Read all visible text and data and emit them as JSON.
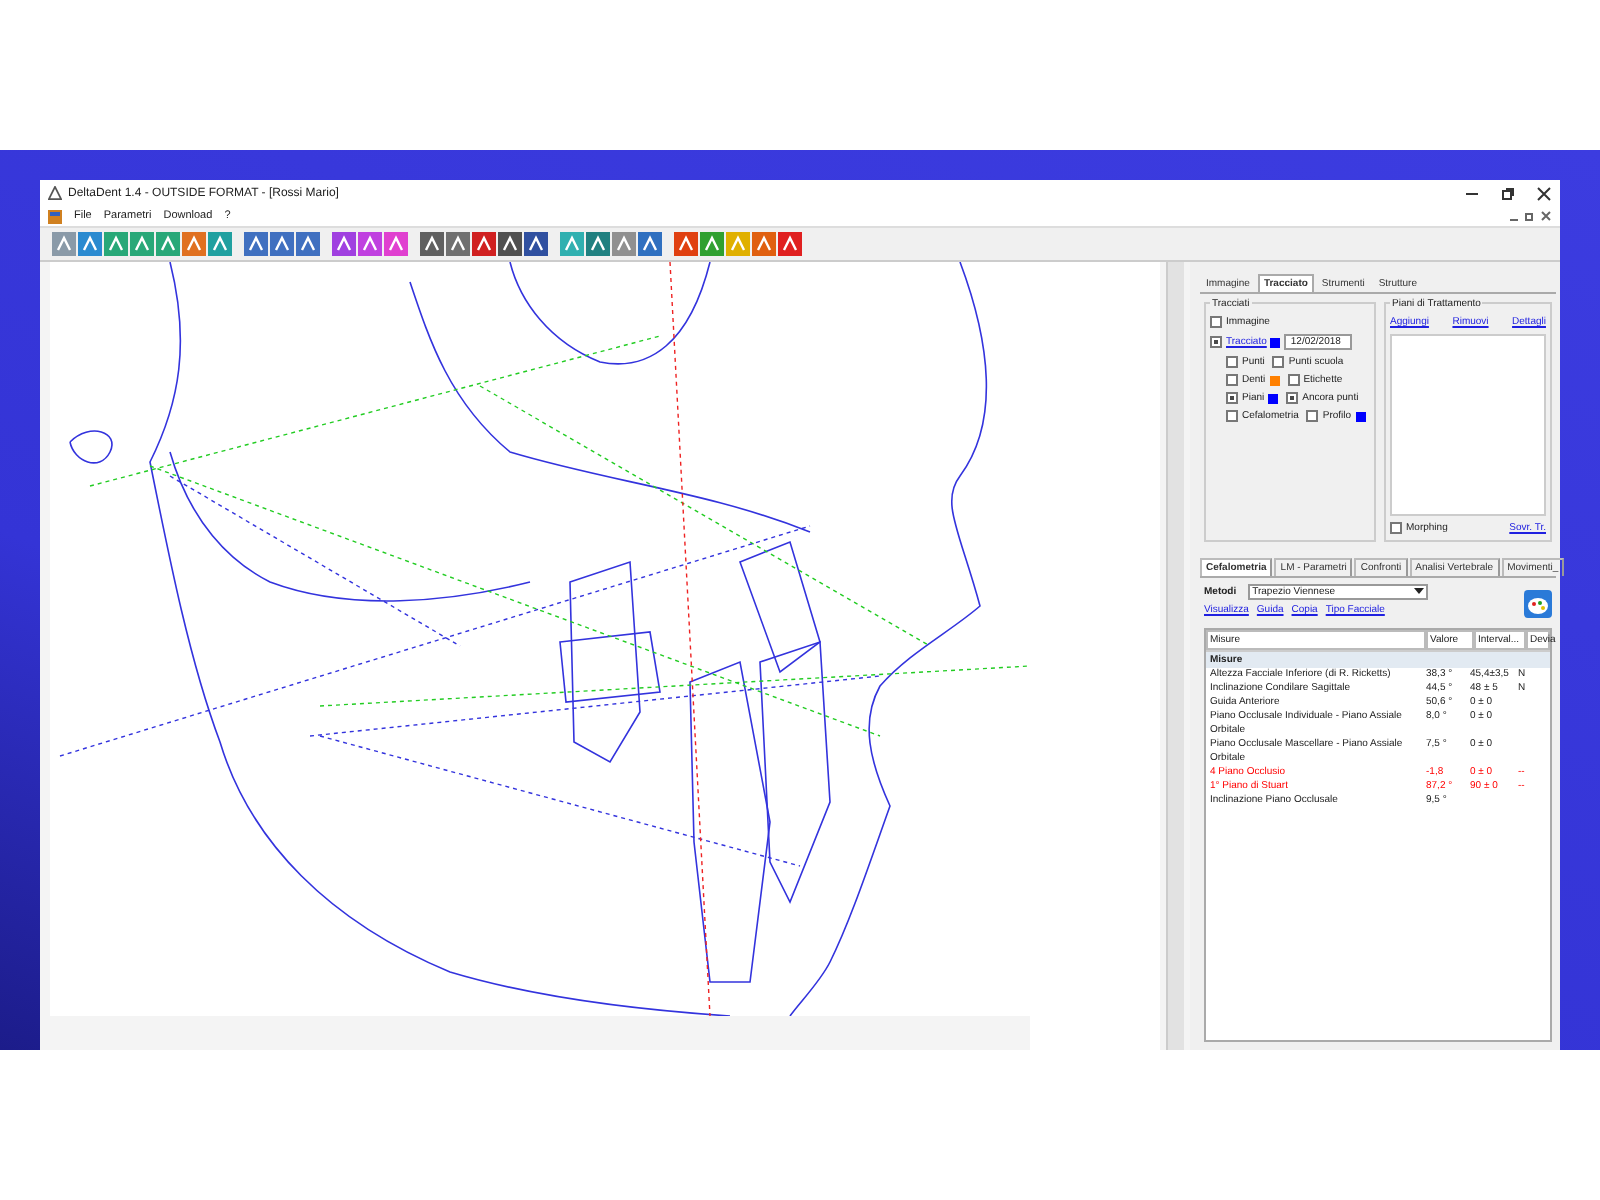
{
  "window": {
    "title": "DeltaDent 1.4 - OUTSIDE FORMAT - [Rossi Mario]"
  },
  "menu": [
    {
      "label": "File"
    },
    {
      "label": "Parametri"
    },
    {
      "label": "Download"
    },
    {
      "label": "?"
    }
  ],
  "top_tabs": [
    {
      "label": "Immagine",
      "selected": false
    },
    {
      "label": "Tracciato",
      "selected": true
    },
    {
      "label": "Strumenti",
      "selected": false
    },
    {
      "label": "Strutture",
      "selected": false
    }
  ],
  "tracciati": {
    "title": "Tracciati",
    "rows": [
      {
        "indent": false,
        "items": [
          {
            "label": "Immagine",
            "checked": false,
            "link": false
          }
        ]
      },
      {
        "indent": false,
        "items": [
          {
            "label": "Tracciato",
            "checked": true,
            "link": true,
            "color": "#0000ff",
            "date": "12/02/2018"
          }
        ]
      },
      {
        "indent": true,
        "items": [
          {
            "label": "Punti",
            "checked": false,
            "link": false
          },
          {
            "label": "Punti scuola",
            "checked": false,
            "link": false
          }
        ]
      },
      {
        "indent": true,
        "items": [
          {
            "label": "Denti",
            "checked": false,
            "link": false,
            "color": "#ff8000"
          },
          {
            "label": "Etichette",
            "checked": false,
            "link": false
          }
        ]
      },
      {
        "indent": true,
        "items": [
          {
            "label": "Piani",
            "checked": true,
            "link": false,
            "color": "#0000ff"
          },
          {
            "label": "Ancora punti",
            "checked": true,
            "link": false
          }
        ]
      },
      {
        "indent": true,
        "items": [
          {
            "label": "Cefalometria",
            "checked": false,
            "link": false
          },
          {
            "label": "Profilo",
            "checked": false,
            "link": false,
            "color": "#0000ff"
          }
        ]
      }
    ]
  },
  "piani": {
    "title": "Piani di Trattamento",
    "links": [
      "Aggiungi",
      "Rimuovi",
      "Dettagli"
    ],
    "morphing": {
      "label": "Morphing",
      "checked": false
    },
    "link": "Sovr. Tr."
  },
  "bottom_tabs": [
    {
      "label": "Cefalometria",
      "selected": true
    },
    {
      "label": "LM - Parametri",
      "selected": false
    },
    {
      "label": "Confronti",
      "selected": false
    },
    {
      "label": "Analisi Vertebrale",
      "selected": false
    },
    {
      "label": "Movimenti_",
      "selected": false
    }
  ],
  "metodi": {
    "label": "Metodi",
    "value": "Trapezio Viennese"
  },
  "links": [
    "Visualizza",
    "Guida",
    "Copia",
    "Tipo Facciale"
  ],
  "table": {
    "columns": [
      "Misure",
      "Valore",
      "Interval...",
      "Devia"
    ],
    "rows": [
      {
        "kind": "group",
        "cells": [
          "Misure"
        ]
      },
      {
        "kind": "row",
        "alert": false,
        "cells": [
          "Altezza Facciale Inferiore (di R. Ricketts)",
          "38,3 °",
          "45,4±3,5",
          "N"
        ]
      },
      {
        "kind": "row",
        "alert": false,
        "cells": [
          "Inclinazione Condilare Sagittale",
          "44,5 °",
          "48 ± 5",
          "N"
        ]
      },
      {
        "kind": "row",
        "alert": false,
        "cells": [
          "Guida Anteriore",
          "50,6 °",
          "0 ± 0",
          ""
        ]
      },
      {
        "kind": "row",
        "alert": false,
        "cells": [
          "Piano Occlusale Individuale - Piano Assiale Orbitale",
          "8,0 °",
          "0 ± 0",
          ""
        ]
      },
      {
        "kind": "row",
        "alert": false,
        "cells": [
          "Piano Occlusale Mascellare - Piano Assiale Orbitale",
          "7,5 °",
          "0 ± 0",
          ""
        ]
      },
      {
        "kind": "row",
        "alert": true,
        "cells": [
          "4 Piano Occlusio",
          "-1,8",
          "0 ± 0",
          "--"
        ]
      },
      {
        "kind": "row",
        "alert": true,
        "cells": [
          "1° Piano di Stuart",
          "87,2 °",
          "90 ± 0",
          "--"
        ]
      },
      {
        "kind": "row",
        "alert": false,
        "cells": [
          "Inclinazione Piano Occlusale",
          "9,5 °",
          "",
          ""
        ]
      }
    ]
  }
}
